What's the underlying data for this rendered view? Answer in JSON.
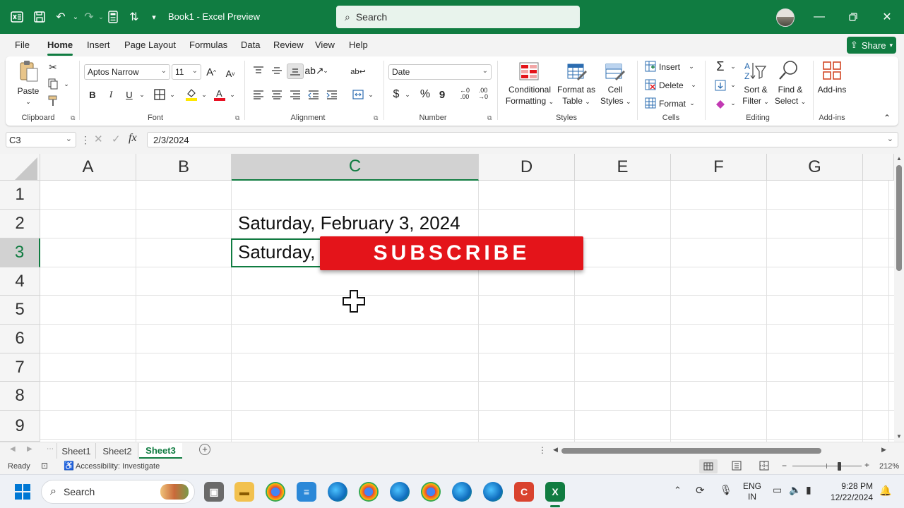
{
  "colors": {
    "excel_green": "#107c41",
    "subscribe_red": "#e4141a"
  },
  "titlebar": {
    "title": "Book1  -  Excel Preview",
    "search_placeholder": "Search"
  },
  "menu": {
    "items": [
      "File",
      "Home",
      "Insert",
      "Page Layout",
      "Formulas",
      "Data",
      "Review",
      "View",
      "Help"
    ],
    "active": "Home",
    "share_label": "Share"
  },
  "ribbon": {
    "clipboard": {
      "paste": "Paste",
      "label": "Clipboard"
    },
    "font": {
      "name": "Aptos Narrow",
      "size": "11",
      "label": "Font",
      "bold": "B",
      "italic": "I",
      "underline": "U",
      "grow": "A",
      "shrink": "A"
    },
    "alignment": {
      "label": "Alignment"
    },
    "number": {
      "format": "Date",
      "label": "Number",
      "currency": "$",
      "percent": "%",
      "comma": "9"
    },
    "styles": {
      "conditional": "Conditional",
      "conditional2": "Formatting",
      "format_table": "Format as",
      "format_table2": "Table",
      "cell_styles": "Cell",
      "cell_styles2": "Styles",
      "label": "Styles"
    },
    "cells": {
      "insert": "Insert",
      "delete": "Delete",
      "format": "Format",
      "label": "Cells"
    },
    "editing": {
      "sort": "Sort &",
      "sort2": "Filter",
      "find": "Find &",
      "find2": "Select",
      "label": "Editing"
    },
    "addins": {
      "addins": "Add-ins",
      "label": "Add-ins"
    }
  },
  "formula_bar": {
    "cell_ref": "C3",
    "value": "2/3/2024",
    "fx": "fx"
  },
  "grid": {
    "columns": [
      "A",
      "B",
      "C",
      "D",
      "E",
      "F",
      "G"
    ],
    "selected_column": "C",
    "rows": [
      "1",
      "2",
      "3",
      "4",
      "5",
      "6",
      "7",
      "8",
      "9"
    ],
    "selected_row": "3",
    "c2": "Saturday, February 3, 2024",
    "c3": "Saturday,"
  },
  "overlay": {
    "subscribe": "SUBSCRIBE"
  },
  "sheets": {
    "tabs": [
      "Sheet1",
      "Sheet2",
      "Sheet3"
    ],
    "active": "Sheet3"
  },
  "status": {
    "ready": "Ready",
    "accessibility": "Accessibility: Investigate",
    "zoom": "212%"
  },
  "taskbar": {
    "search": "Search",
    "lang1": "ENG",
    "lang2": "IN",
    "time": "9:28 PM",
    "date": "12/22/2024"
  }
}
